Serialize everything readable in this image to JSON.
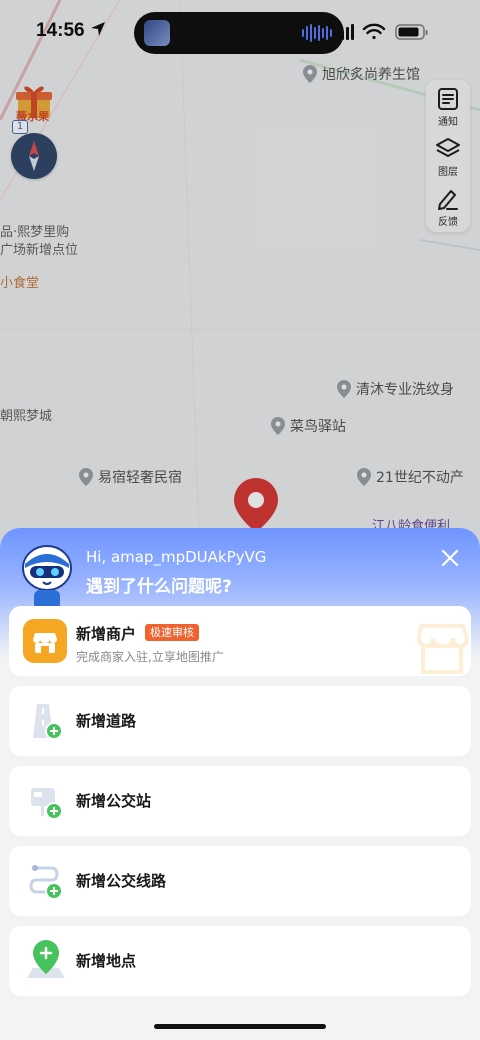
{
  "status_bar": {
    "time": "14:56"
  },
  "map": {
    "pois": [
      "旭欣炙尚养生馆",
      "清沐专业洗纹身",
      "菜鸟驿站",
      "易宿轻奢民宿",
      "21世纪不动产"
    ],
    "labels": {
      "shop_line1": "品·熙梦里购",
      "shop_line2": "广场新增点位",
      "canteen": "小食堂",
      "city": "朝熙梦城",
      "partial_bottom": "江八龄食便利"
    },
    "gift_label": "薇水果",
    "floor_badge": "1"
  },
  "tools": [
    {
      "label": "通知",
      "icon": "notice-icon"
    },
    {
      "label": "图层",
      "icon": "layers-icon"
    },
    {
      "label": "反馈",
      "icon": "feedback-pen-icon"
    }
  ],
  "sheet": {
    "greeting": "Hi, amap_mpDUAkPyVG",
    "question": "遇到了什么问题呢?",
    "featured": {
      "title": "新增商户",
      "tag": "极速审核",
      "subtitle": "完成商家入驻,立享地图推广"
    },
    "items": [
      {
        "title": "新增道路",
        "icon": "road-plus-icon"
      },
      {
        "title": "新增公交站",
        "icon": "bus-stop-plus-icon"
      },
      {
        "title": "新增公交线路",
        "icon": "bus-route-plus-icon"
      },
      {
        "title": "新增地点",
        "icon": "location-plus-icon"
      }
    ]
  },
  "colors": {
    "accent_blue": "#6e94ff",
    "merchant_orange": "#f5a623",
    "tag_red": "#f0632f",
    "plus_green": "#46c35e",
    "pin_red": "#d93a3a"
  }
}
